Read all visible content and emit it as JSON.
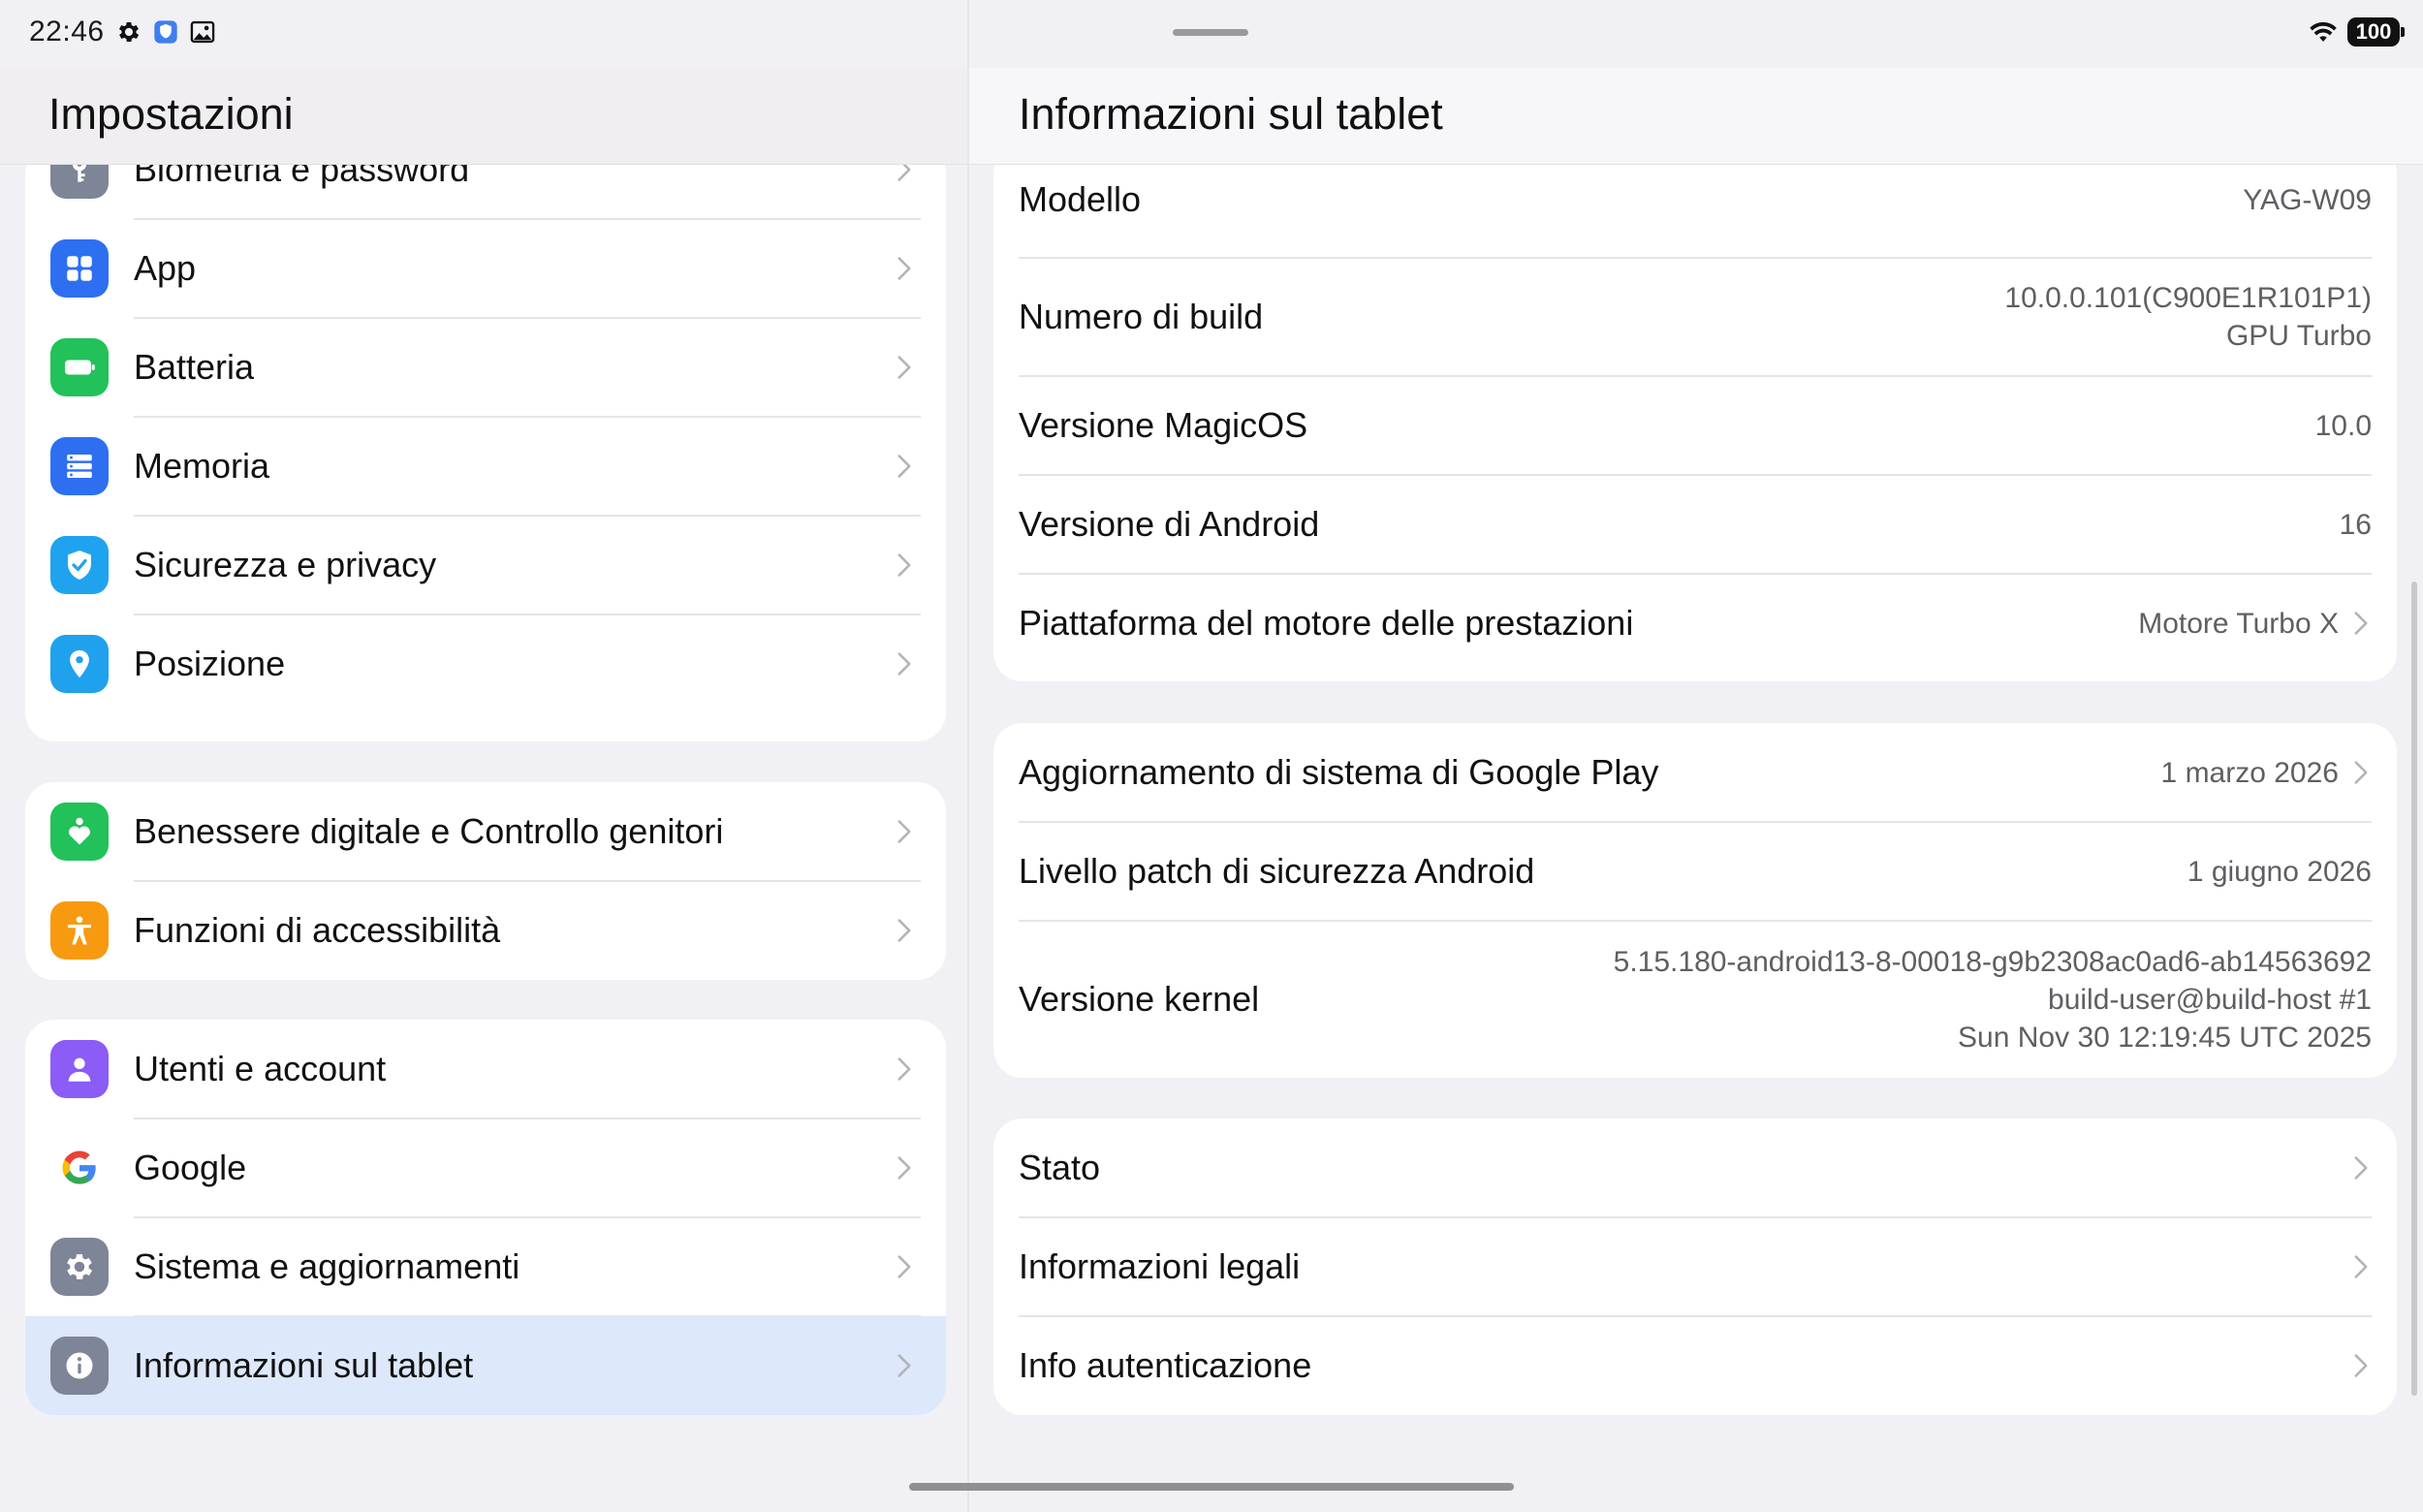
{
  "status": {
    "time": "22:46",
    "icons": [
      "gear-icon",
      "vpn-shield-icon",
      "image-icon"
    ],
    "right_icons": [
      "wifi-icon"
    ],
    "battery": "100"
  },
  "left": {
    "title": "Impostazioni",
    "groups": [
      {
        "items": [
          {
            "label": "Biometria e password",
            "icon": "key-icon",
            "color": "#7d8597"
          },
          {
            "label": "App",
            "icon": "grid-icon",
            "color": "#2e6ff2"
          },
          {
            "label": "Batteria",
            "icon": "battery-icon",
            "color": "#23c15a"
          },
          {
            "label": "Memoria",
            "icon": "storage-icon",
            "color": "#2e6ff2"
          },
          {
            "label": "Sicurezza e privacy",
            "icon": "shield-check-icon",
            "color": "#20a3ee"
          },
          {
            "label": "Posizione",
            "icon": "location-pin-icon",
            "color": "#1fa1ee"
          }
        ]
      },
      {
        "items": [
          {
            "label": "Benessere digitale e Controllo genitori",
            "icon": "heart-person-icon",
            "color": "#23c15a"
          },
          {
            "label": "Funzioni di accessibilità",
            "icon": "accessibility-icon",
            "color": "#f79a10"
          }
        ]
      },
      {
        "items": [
          {
            "label": "Utenti e account",
            "icon": "user-icon",
            "color": "#8b5cf6"
          },
          {
            "label": "Google",
            "icon": "google-icon",
            "color": "#ffffff"
          },
          {
            "label": "Sistema e aggiornamenti",
            "icon": "gear-icon",
            "color": "#7d8597"
          },
          {
            "label": "Informazioni sul tablet",
            "icon": "info-icon",
            "color": "#7d8597",
            "selected": true
          }
        ]
      }
    ]
  },
  "right": {
    "title": "Informazioni sul tablet",
    "card1": [
      {
        "label": "Modello",
        "value": [
          "YAG-W09"
        ],
        "chevron": false
      },
      {
        "label": "Numero di build",
        "value": [
          "10.0.0.101(C900E1R101P1)",
          "GPU Turbo"
        ],
        "chevron": false
      },
      {
        "label": "Versione MagicOS",
        "value": [
          "10.0"
        ],
        "chevron": false
      },
      {
        "label": "Versione di Android",
        "value": [
          "16"
        ],
        "chevron": false
      },
      {
        "label": "Piattaforma del motore delle prestazioni",
        "value": [
          "Motore Turbo X"
        ],
        "chevron": true
      }
    ],
    "card2": [
      {
        "label": "Aggiornamento di sistema di Google Play",
        "value": [
          "1 marzo 2026"
        ],
        "chevron": true
      },
      {
        "label": "Livello patch di sicurezza Android",
        "value": [
          "1 giugno 2026"
        ],
        "chevron": false
      },
      {
        "label": "Versione kernel",
        "value": [
          "5.15.180-android13-8-00018-g9b2308ac0ad6-ab14563692",
          "build-user@build-host #1",
          "Sun Nov 30 12:19:45 UTC 2025"
        ],
        "chevron": false
      }
    ],
    "card3": [
      {
        "label": "Stato",
        "chevron": true
      },
      {
        "label": "Informazioni legali",
        "chevron": true
      },
      {
        "label": "Info autenticazione",
        "chevron": true
      }
    ]
  }
}
